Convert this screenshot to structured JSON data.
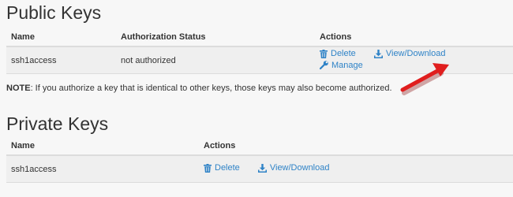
{
  "public_keys": {
    "title": "Public Keys",
    "columns": [
      "Name",
      "Authorization Status",
      "Actions"
    ],
    "rows": [
      {
        "name": "ssh1access",
        "status": "not authorized",
        "actions": {
          "delete": "Delete",
          "view_download": "View/Download",
          "manage": "Manage"
        }
      }
    ]
  },
  "note": {
    "label": "NOTE",
    "text": ": If you authorize a key that is identical to other keys, those keys may also become authorized."
  },
  "private_keys": {
    "title": "Private Keys",
    "columns": [
      "Name",
      "Actions"
    ],
    "rows": [
      {
        "name": "ssh1access",
        "actions": {
          "delete": "Delete",
          "view_download": "View/Download"
        }
      }
    ]
  },
  "colors": {
    "link": "#2f83c7",
    "annotation_arrow": "#e01e1e"
  },
  "icons": [
    "trash-icon",
    "download-icon",
    "wrench-icon"
  ]
}
